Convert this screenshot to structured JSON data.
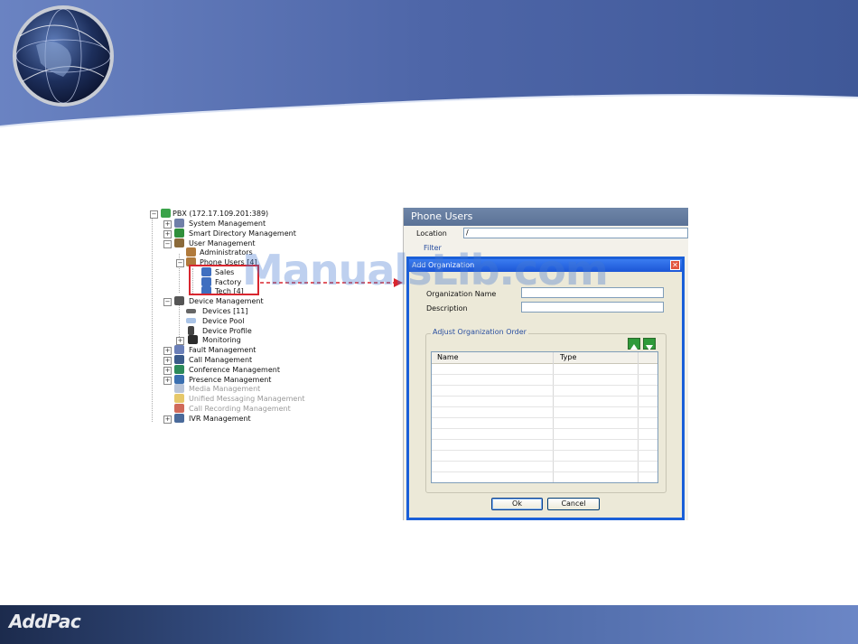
{
  "branding": {
    "footer_logo": "AddPac",
    "watermark": "ManualsLib.com"
  },
  "colors": {
    "header_blue": "#4f66a8",
    "footer_blue": "#2b4680",
    "highlight_red": "#d8262f",
    "dialog_border": "#1a5fd8"
  },
  "tree": {
    "items": [
      {
        "label": "PBX (172.17.109.201:389)",
        "icon": "pbx-icon"
      },
      {
        "label": "System Management",
        "icon": "system-icon"
      },
      {
        "label": "Smart Directory Management",
        "icon": "directory-icon"
      },
      {
        "label": "User Management",
        "icon": "users-icon"
      },
      {
        "label": "Administrators",
        "icon": "admin-icon"
      },
      {
        "label": "Phone Users [4]",
        "icon": "phone-users-icon"
      },
      {
        "label": "Sales",
        "icon": "org-icon"
      },
      {
        "label": "Factory",
        "icon": "org-icon"
      },
      {
        "label": "Tech [4]",
        "icon": "org-icon"
      },
      {
        "label": "Device Management",
        "icon": "device-icon"
      },
      {
        "label": "Devices [11]",
        "icon": "devices-icon"
      },
      {
        "label": "Device Pool",
        "icon": "pool-icon"
      },
      {
        "label": "Device Profile",
        "icon": "profile-icon"
      },
      {
        "label": "Monitoring",
        "icon": "monitor-icon"
      },
      {
        "label": "Fault Management",
        "icon": "fault-icon"
      },
      {
        "label": "Call Management",
        "icon": "call-icon"
      },
      {
        "label": "Conference Management",
        "icon": "conference-icon"
      },
      {
        "label": "Presence Management",
        "icon": "presence-icon"
      },
      {
        "label": "Media Management",
        "icon": "media-icon"
      },
      {
        "label": "Unified Messaging Management",
        "icon": "messaging-icon"
      },
      {
        "label": "Call Recording Management",
        "icon": "recording-icon"
      },
      {
        "label": "IVR Management",
        "icon": "ivr-icon"
      }
    ]
  },
  "phone_users": {
    "title": "Phone Users",
    "location_label": "Location",
    "location_value": "/",
    "filter_label": "Filter"
  },
  "dialog": {
    "title": "Add Organization",
    "org_name_label": "Organization Name",
    "org_name_value": "",
    "description_label": "Description",
    "description_value": "",
    "order_group_label": "Adjust Organization Order",
    "columns": [
      "Name",
      "Type"
    ],
    "ok_label": "Ok",
    "cancel_label": "Cancel",
    "close_glyph": "✕"
  }
}
